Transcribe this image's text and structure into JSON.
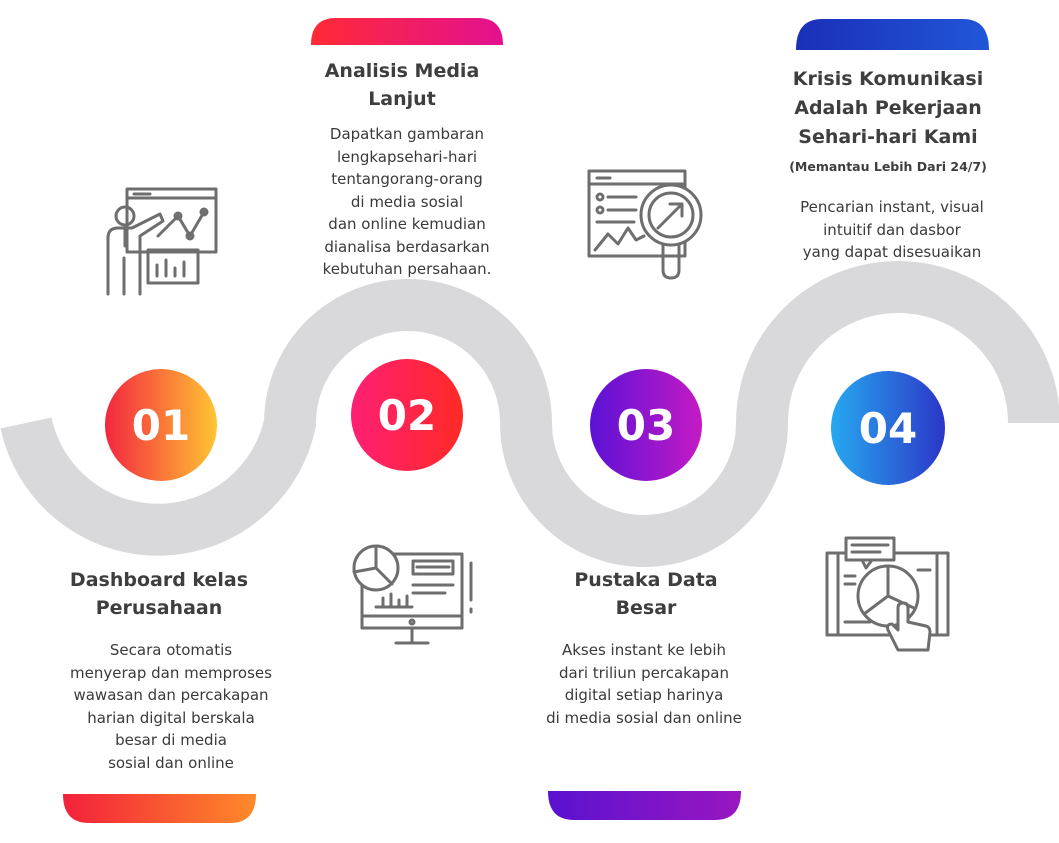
{
  "steps": [
    {
      "number": "01",
      "title": "Dashboard kelas\nPerusahaan",
      "description": "Secara otomatis\nmenyerap dan memproses\nwawasan dan percakapan\nharian digital berskala\nbesar di media\nsosial dan online",
      "icon": "presentation-chart-icon"
    },
    {
      "number": "02",
      "title": "Analisis Media\nLanjut",
      "description": "Dapatkan gambaran\nlengkapsehari-hari\ntentangorang-orang\ndi media sosial\ndan online kemudian\ndianalisa berdasarkan\nkebutuhan persahaan.",
      "icon": "monitor-analytics-icon"
    },
    {
      "number": "03",
      "title": "Pustaka Data\nBesar",
      "description": "Akses instant ke lebih\ndari triliun percakapan\ndigital setiap harinya\ndi media sosial dan online",
      "icon": "magnifier-report-icon"
    },
    {
      "number": "04",
      "title": "Krisis Komunikasi\nAdalah Pekerjaan\nSehari-hari Kami",
      "subtitle": "(Memantau Lebih Dari 24/7)",
      "description": "Pencarian instant, visual\nintuitif dan dasbor\nyang dapat disesuaikan",
      "icon": "touch-dashboard-icon"
    }
  ],
  "colors": {
    "wave": "#d9d8db",
    "icon_stroke": "#6e6e6e",
    "step1": [
      "#f3263f",
      "#ffc533"
    ],
    "step2": [
      "#ff1f75",
      "#ff2a25"
    ],
    "step3": [
      "#5b12d6",
      "#c51ac4"
    ],
    "step4": [
      "#27a9f0",
      "#2b36c8"
    ]
  }
}
